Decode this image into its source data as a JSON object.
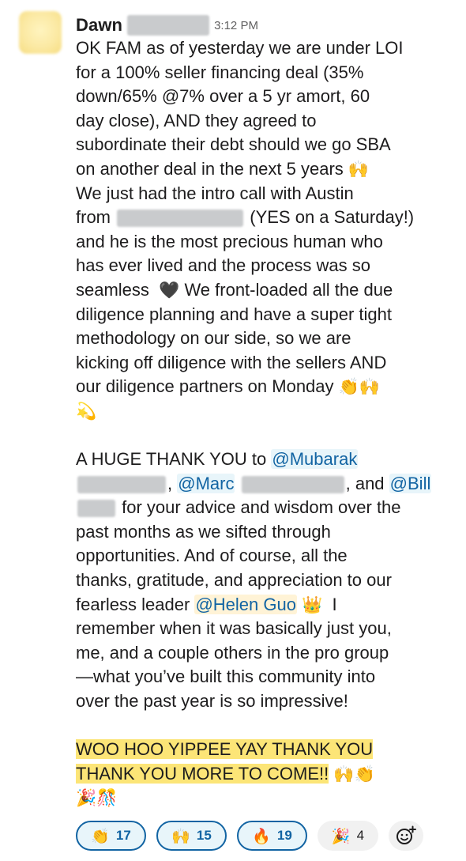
{
  "message": {
    "author": "Dawn",
    "timestamp": "3:12 PM",
    "lines": {
      "l01": "OK FAM as of yesterday we are under LOI",
      "l02": "for a 100% seller financing deal (35%",
      "l03": "down/65% @7% over a 5 yr amort, 60",
      "l04": "day close), AND they agreed to",
      "l05": "subordinate their debt should we go SBA",
      "l06": "on another deal in the next 5 years",
      "l07": "We just had the intro call with Austin",
      "l08a": "from",
      "l08b": "(YES on a Saturday!)",
      "l09": "and he is the most precious human who",
      "l10": "has ever lived and the process was so",
      "l11a": "seamless",
      "l11b": "We front-loaded all the due",
      "l12": "diligence planning and have a super tight",
      "l13": "methodology on our side, so we are",
      "l14": "kicking off diligence with the sellers AND",
      "l15": "our diligence partners on Monday",
      "l17a": "A HUGE THANK YOU to",
      "l18a": ",",
      "l18b": ", and",
      "l19": "for your advice and wisdom over the",
      "l20": "past months as we sifted through",
      "l21": "opportunities.  And of course, all the",
      "l22": "thanks, gratitude, and appreciation to our",
      "l23a": "fearless leader",
      "l23b": "I",
      "l24": "remember when it was basically just you,",
      "l25": "me, and a couple others in the pro group",
      "l26": "—what you’ve built this community into",
      "l27": "over the past year is so impressive!",
      "l29": "WOO HOO YIPPEE YAY THANK YOU",
      "l30": "THANK YOU MORE TO COME!!"
    },
    "mentions": {
      "mubarak": "@Mubarak",
      "marc": "@Marc",
      "bill": "@Bill",
      "helen": "@Helen Guo"
    },
    "emojis": {
      "raised_hands": "🙌",
      "clap": "👏",
      "black_heart": "🖤",
      "dizzy": "💫",
      "crown": "👑",
      "tada": "🎉",
      "confetti": "🎊"
    }
  },
  "reactions": [
    {
      "emoji": "👏",
      "icon": "clap-icon",
      "count": "17",
      "active": true
    },
    {
      "emoji": "🙌",
      "icon": "raised-hands-icon",
      "count": "15",
      "active": true
    },
    {
      "emoji": "🔥",
      "icon": "fire-icon",
      "count": "19",
      "active": true
    },
    {
      "emoji": "🎉",
      "icon": "party-popper-icon",
      "count": "4",
      "active": false
    }
  ],
  "add_reaction_icon": "add-reaction-icon",
  "colors": {
    "mention_text": "#1264a3",
    "mention_bg": "#e8f5fa",
    "self_mention_bg": "#fff3d6",
    "highlight": "#fce577",
    "timestamp": "#616061"
  }
}
